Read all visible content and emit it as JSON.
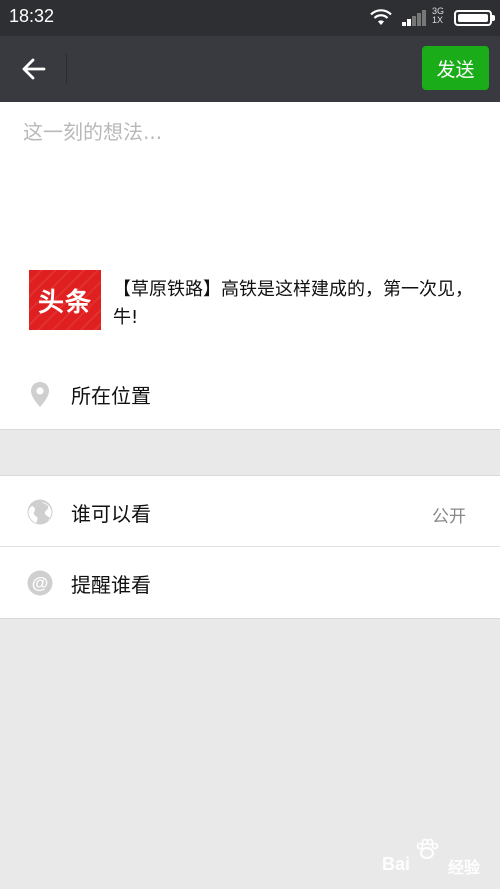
{
  "status_bar": {
    "time": "18:32",
    "network_top": "3G",
    "network_bottom": "1X"
  },
  "top_bar": {
    "send_label": "发送"
  },
  "compose": {
    "placeholder": "这一刻的想法..."
  },
  "shared_link": {
    "thumbnail_text": "头条",
    "title": "【草原铁路】高铁是这样建成的，第一次见，牛!"
  },
  "options": {
    "location_label": "所在位置",
    "visibility_label": "谁可以看",
    "visibility_value": "公开",
    "remind_label": "提醒谁看"
  },
  "watermark": {
    "brand": "Bai",
    "suffix": "经验"
  },
  "colors": {
    "status_bar": "#2e2f33",
    "top_bar": "#393a3f",
    "send_button": "#1aad19",
    "thumbnail": "#e02020",
    "background": "#e9e9e9"
  }
}
